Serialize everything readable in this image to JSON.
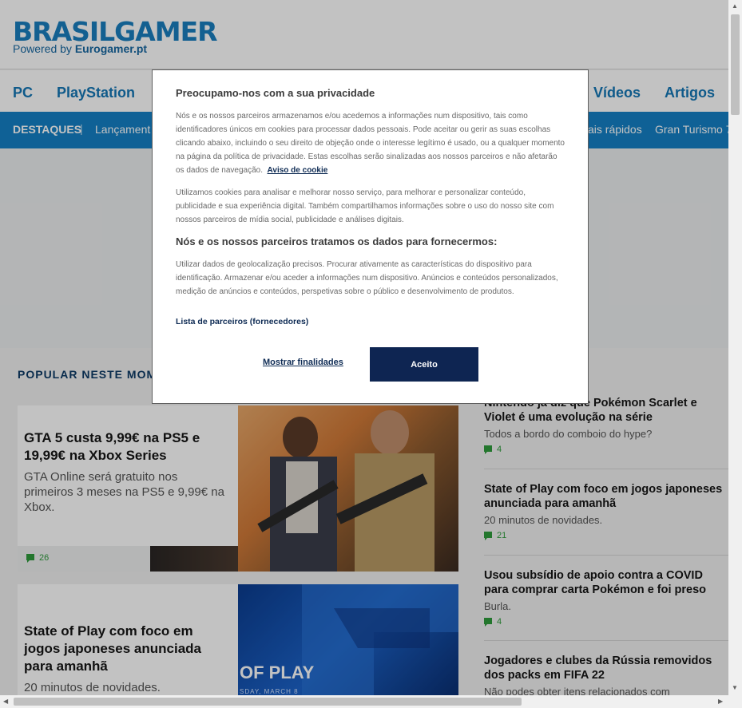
{
  "site": {
    "logo": "BRASILGAMER",
    "tagline_prefix": "Powered by ",
    "tagline_brand": "Eurogamer.pt"
  },
  "platform_nav": {
    "items": [
      "PC",
      "PlayStation",
      "Vídeos",
      "Artigos"
    ]
  },
  "sub_nav": {
    "highlights_label": "DESTAQUES",
    "separator": "|",
    "items": [
      "Lançament",
      "ais rápidos",
      "Gran Turismo 7"
    ]
  },
  "section": {
    "title": "POPULAR NESTE MOMENTO"
  },
  "main_articles": [
    {
      "title": "GTA 5 custa 9,99€ na PS5 e 19,99€ na Xbox Series",
      "subtitle": "GTA Online será gratuito nos primeiros 3 meses na PS5 e 9,99€ na Xbox.",
      "comments": "26"
    },
    {
      "title": "State of Play com foco em jogos japoneses anunciada para amanhã",
      "subtitle": "20 minutos de novidades.",
      "image_text": "OF PLAY",
      "image_small_text": "SDAY, MARCH 8"
    }
  ],
  "side_articles": [
    {
      "title": "Nintendo já diz que Pokémon Scarlet e Violet é uma evolução na série",
      "subtitle": "Todos a bordo do comboio do hype?",
      "comments": "4"
    },
    {
      "title": "State of Play com foco em jogos japoneses anunciada para amanhã",
      "subtitle": "20 minutos de novidades.",
      "comments": "21"
    },
    {
      "title": "Usou subsídio de apoio contra a COVID para comprar carta Pokémon e foi preso",
      "subtitle": "Burla.",
      "comments": "4"
    },
    {
      "title": "Jogadores e clubes da Rússia removidos dos packs em FIFA 22",
      "subtitle": "Não podes obter itens relacionados com"
    }
  ],
  "consent": {
    "title": "Preocupamo-nos com a sua privacidade",
    "paragraph1": "Nós e os nossos parceiros armazenamos e/ou acedemos a informações num dispositivo, tais como identificadores únicos em cookies para processar dados pessoais. Pode aceitar ou gerir as suas escolhas clicando abaixo, incluindo o seu direito de objeção onde o interesse legítimo é usado, ou a qualquer momento na página da política de privacidade. Estas escolhas serão sinalizadas aos nossos parceiros e não afetarão os dados de navegação.",
    "cookie_link": "Aviso de cookie",
    "paragraph2": "Utilizamos cookies para analisar e melhorar nosso serviço, para melhorar e personalizar conteúdo, publicidade e sua experiência digital. Também compartilhamos informações sobre o uso do nosso site com nossos parceiros de mídia social, publicidade e análises digitais.",
    "heading2": "Nós e os nossos parceiros tratamos os dados para fornecermos:",
    "paragraph3": "Utilizar dados de geolocalização precisos. Procurar ativamente as características do dispositivo para identificação. Armazenar e/ou aceder a informações num dispositivo. Anúncios e conteúdos personalizados, medição de anúncios e conteúdos, perspetivas sobre o público e desenvolvimento de produtos.",
    "partners_link": "Lista de parceiros (fornecedores)",
    "show_purposes": "Mostrar finalidades",
    "accept": "Aceito"
  },
  "colors": {
    "brand_blue": "#1580c6",
    "dark_navy": "#0e2552",
    "comment_green": "#2e9b3c"
  }
}
